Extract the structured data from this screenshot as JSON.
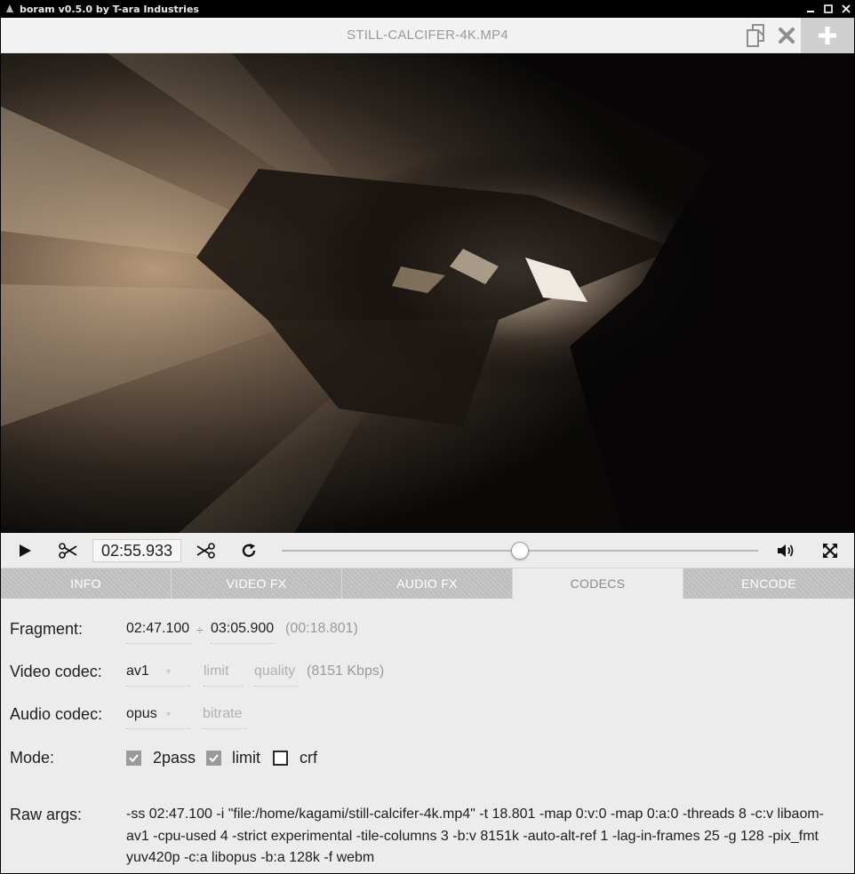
{
  "window": {
    "title": "boram v0.5.0 by T-ara Industries"
  },
  "header": {
    "filename": "STILL-CALCIFER-4K.MP4"
  },
  "player": {
    "time": "02:55.933",
    "seek_position": 0.5
  },
  "tabs": [
    {
      "label": "INFO",
      "active": false
    },
    {
      "label": "VIDEO FX",
      "active": false
    },
    {
      "label": "AUDIO FX",
      "active": false
    },
    {
      "label": "CODECS",
      "active": true
    },
    {
      "label": "ENCODE",
      "active": false
    }
  ],
  "codecs": {
    "fragment_label": "Fragment:",
    "fragment_start": "02:47.100",
    "fragment_sep": "÷",
    "fragment_end": "03:05.900",
    "fragment_duration": "(00:18.801)",
    "video_label": "Video codec:",
    "video_codec": "av1",
    "video_limit_placeholder": "limit",
    "video_quality_placeholder": "quality",
    "video_bitrate": "(8151 Kbps)",
    "audio_label": "Audio codec:",
    "audio_codec": "opus",
    "audio_bitrate_placeholder": "bitrate",
    "mode_label": "Mode:",
    "mode_options": [
      {
        "label": "2pass",
        "checked": true
      },
      {
        "label": "limit",
        "checked": true
      },
      {
        "label": "crf",
        "checked": false
      }
    ],
    "raw_label": "Raw args:",
    "raw_args": "-ss 02:47.100 -i \"file:/home/kagami/still-calcifer-4k.mp4\" -t 18.801 -map 0:v:0 -map 0:a:0 -threads 8 -c:v libaom-av1 -cpu-used 4 -strict experimental -tile-columns 3 -b:v 8151k -auto-alt-ref 1 -lag-in-frames 25 -g 128 -pix_fmt yuv420p -c:a libopus -b:a 128k -f webm"
  },
  "colors": {
    "tab_inactive": "#c3c3c3",
    "tab_active": "#ececec",
    "panel_bg": "#ececec"
  }
}
